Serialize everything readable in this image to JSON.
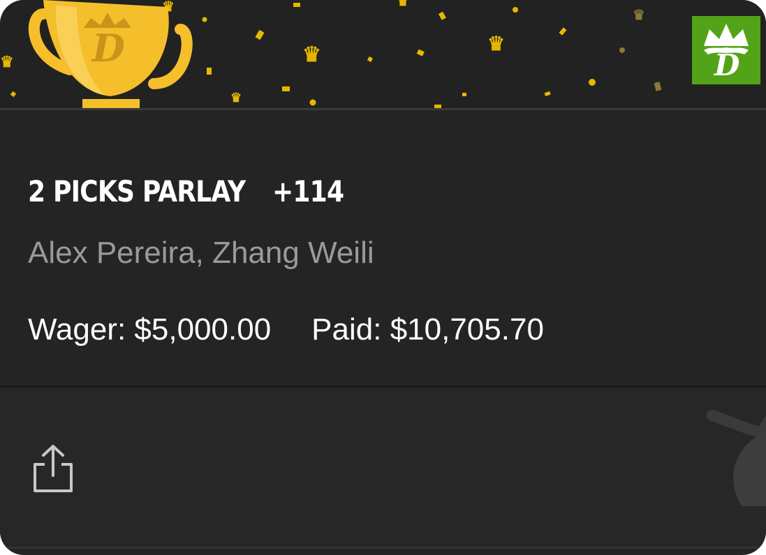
{
  "banner": {
    "trophy_icon": "trophy-icon",
    "brand_icon": "crown-d-logo-icon",
    "colors": {
      "trophy_gold": "#f4bf2a",
      "confetti_gold": "#e6b800",
      "brand_green": "#53a318",
      "background": "#222222"
    }
  },
  "bet": {
    "title": "2 PICKS PARLAY",
    "odds": "+114",
    "fighters": "Alex Pereira, Zhang Weili",
    "wager_label": "Wager:",
    "wager_value": "$5,000.00",
    "paid_label": "Paid:",
    "paid_value": "$10,705.70"
  },
  "footer": {
    "share_icon": "share-icon"
  }
}
